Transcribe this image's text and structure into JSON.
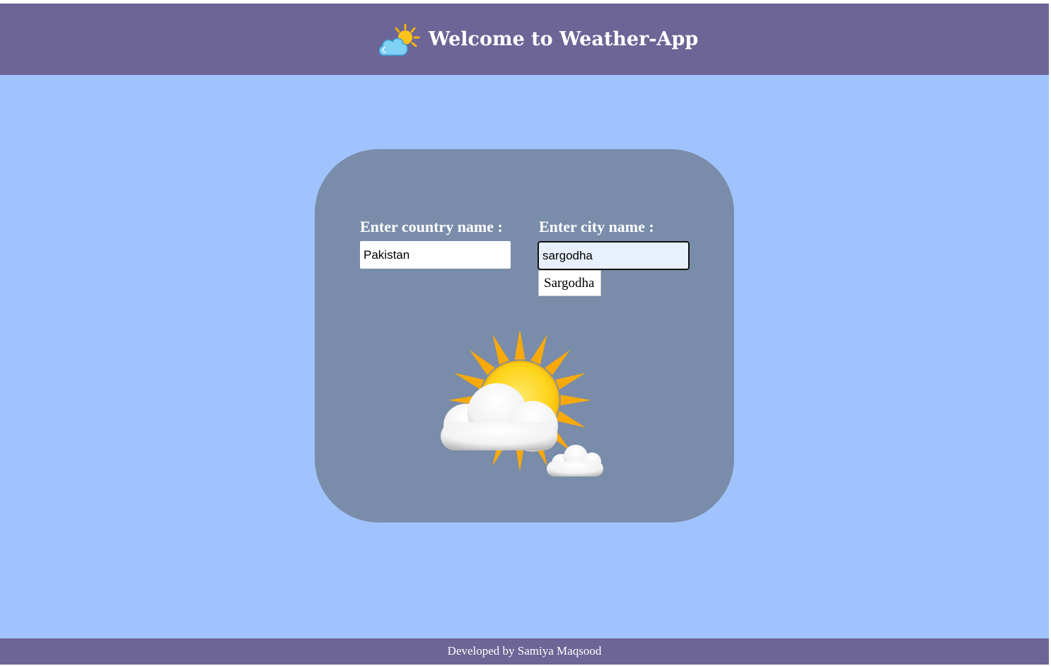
{
  "header": {
    "title": "Welcome to Weather-App",
    "icon": "partly-cloudy-icon"
  },
  "form": {
    "country_label": "Enter country name :",
    "country_value": "Pakistan",
    "city_label": "Enter city name :",
    "city_value": "sargodha",
    "autocomplete_suggestion": "Sargodha"
  },
  "illustration": {
    "icon": "sun-behind-clouds-icon"
  },
  "footer": {
    "text": "Developed by Samiya Maqsood"
  },
  "colors": {
    "page_background": "#a0c3fd",
    "header_footer": "#6c6596",
    "card": "#798ca9",
    "sun": "#fdd41a",
    "sun_rays": "#f7a90c"
  }
}
